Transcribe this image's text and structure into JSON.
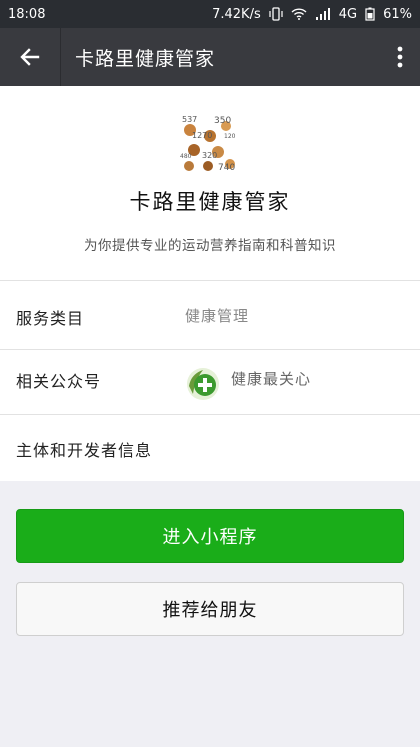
{
  "status_bar": {
    "time": "18:08",
    "network_speed": "7.42K/s",
    "network_type": "4G",
    "battery": "61%"
  },
  "nav": {
    "title": "卡路里健康管家",
    "back_icon": "arrow-left-icon",
    "more_icon": "vertical-dots-icon"
  },
  "app": {
    "name": "卡路里健康管家",
    "description": "为你提供专业的运动营养指南和科普知识",
    "logo_numbers": [
      "537",
      "350",
      "1270",
      "120",
      "480",
      "320",
      "740"
    ]
  },
  "rows": {
    "service_label": "服务类目",
    "service_value": "健康管理",
    "account_label": "相关公众号",
    "account_value": "健康最关心",
    "developer_label": "主体和开发者信息"
  },
  "buttons": {
    "enter": "进入小程序",
    "recommend": "推荐给朋友"
  },
  "colors": {
    "primary_green": "#1aad19",
    "navbar": "#393a3f",
    "background": "#efeff4"
  }
}
